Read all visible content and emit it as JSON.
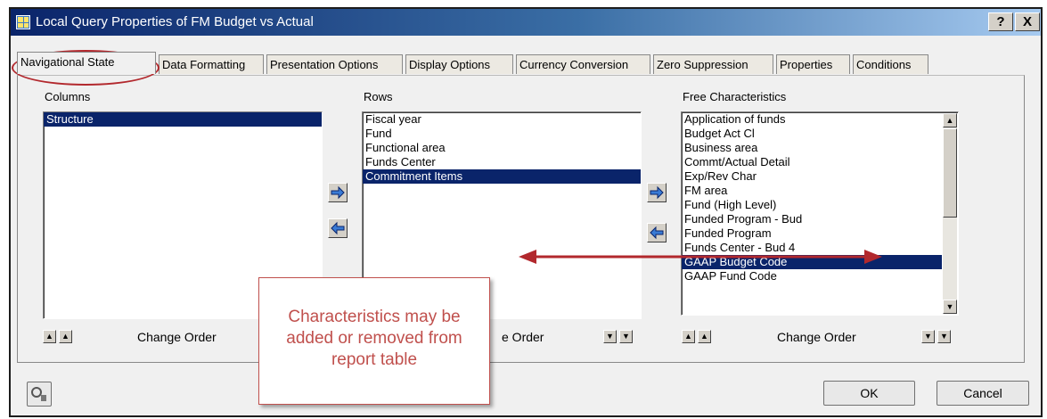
{
  "window": {
    "title": "Local Query Properties of FM Budget vs Actual",
    "help_label": "?",
    "close_label": "X"
  },
  "tabs": [
    {
      "label": "Navigational State"
    },
    {
      "label": "Data Formatting"
    },
    {
      "label": "Presentation Options"
    },
    {
      "label": "Display Options"
    },
    {
      "label": "Currency Conversion"
    },
    {
      "label": "Zero Suppression"
    },
    {
      "label": "Properties"
    },
    {
      "label": "Conditions"
    }
  ],
  "columns": {
    "label": "Columns",
    "items": [
      "Structure"
    ],
    "selected_index": 0
  },
  "rows": {
    "label": "Rows",
    "items": [
      "Fiscal year",
      "Fund",
      "Functional area",
      "Funds Center",
      "Commitment Items"
    ],
    "selected_index": 4
  },
  "free": {
    "label": "Free Characteristics",
    "items": [
      "Application of funds",
      "Budget Act Cl",
      "Business area",
      "Commt/Actual Detail",
      "Exp/Rev Char",
      "FM area",
      "Fund (High Level)",
      "Funded Program - Bud",
      "Funded Program",
      "Funds Center - Bud 4",
      "GAAP Budget Code",
      "GAAP Fund Code"
    ],
    "selected_index": 10
  },
  "change_order_label": "Change Order",
  "rows_change_order_visible": "e Order",
  "buttons": {
    "ok": "OK",
    "cancel": "Cancel"
  },
  "callout": {
    "line1": "Characteristics may be",
    "line2": "added or removed from",
    "line3": "report table"
  },
  "annotation_color": "#c0504d",
  "selection_color": "#0a246a"
}
